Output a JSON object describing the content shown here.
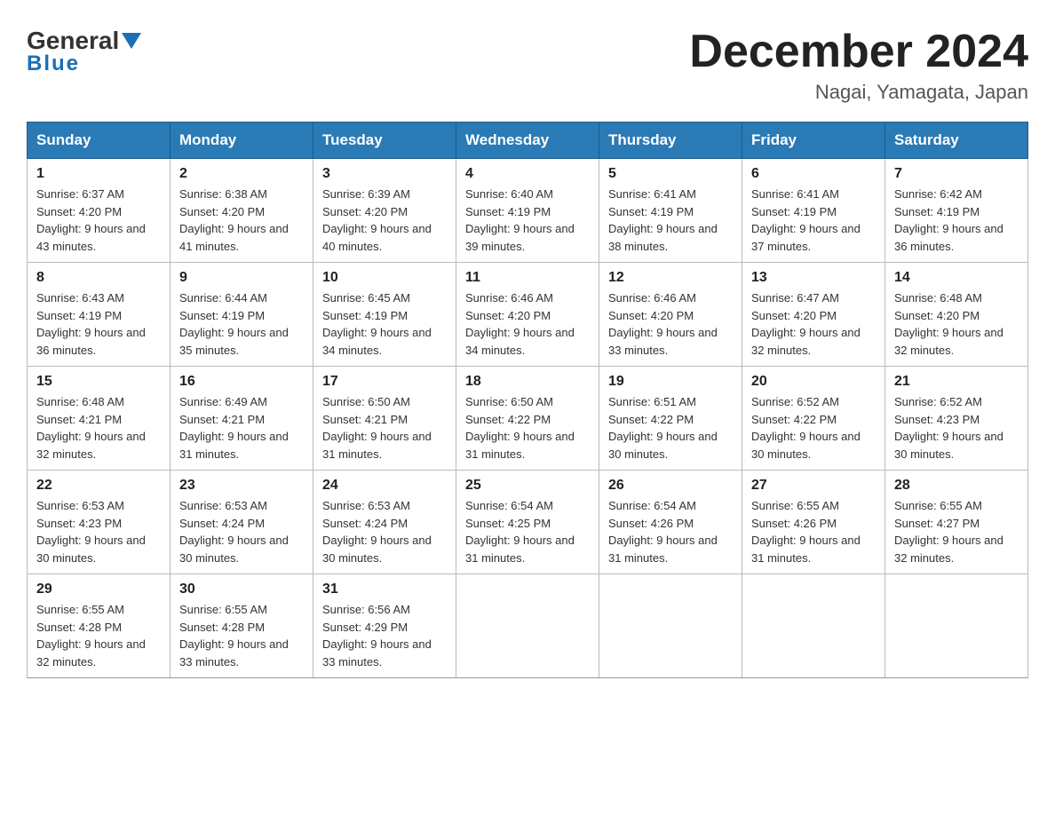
{
  "header": {
    "logo_general": "General",
    "logo_blue": "Blue",
    "title": "December 2024",
    "subtitle": "Nagai, Yamagata, Japan"
  },
  "calendar": {
    "days_of_week": [
      "Sunday",
      "Monday",
      "Tuesday",
      "Wednesday",
      "Thursday",
      "Friday",
      "Saturday"
    ],
    "weeks": [
      [
        {
          "day": "1",
          "sunrise": "6:37 AM",
          "sunset": "4:20 PM",
          "daylight": "9 hours and 43 minutes."
        },
        {
          "day": "2",
          "sunrise": "6:38 AM",
          "sunset": "4:20 PM",
          "daylight": "9 hours and 41 minutes."
        },
        {
          "day": "3",
          "sunrise": "6:39 AM",
          "sunset": "4:20 PM",
          "daylight": "9 hours and 40 minutes."
        },
        {
          "day": "4",
          "sunrise": "6:40 AM",
          "sunset": "4:19 PM",
          "daylight": "9 hours and 39 minutes."
        },
        {
          "day": "5",
          "sunrise": "6:41 AM",
          "sunset": "4:19 PM",
          "daylight": "9 hours and 38 minutes."
        },
        {
          "day": "6",
          "sunrise": "6:41 AM",
          "sunset": "4:19 PM",
          "daylight": "9 hours and 37 minutes."
        },
        {
          "day": "7",
          "sunrise": "6:42 AM",
          "sunset": "4:19 PM",
          "daylight": "9 hours and 36 minutes."
        }
      ],
      [
        {
          "day": "8",
          "sunrise": "6:43 AM",
          "sunset": "4:19 PM",
          "daylight": "9 hours and 36 minutes."
        },
        {
          "day": "9",
          "sunrise": "6:44 AM",
          "sunset": "4:19 PM",
          "daylight": "9 hours and 35 minutes."
        },
        {
          "day": "10",
          "sunrise": "6:45 AM",
          "sunset": "4:19 PM",
          "daylight": "9 hours and 34 minutes."
        },
        {
          "day": "11",
          "sunrise": "6:46 AM",
          "sunset": "4:20 PM",
          "daylight": "9 hours and 34 minutes."
        },
        {
          "day": "12",
          "sunrise": "6:46 AM",
          "sunset": "4:20 PM",
          "daylight": "9 hours and 33 minutes."
        },
        {
          "day": "13",
          "sunrise": "6:47 AM",
          "sunset": "4:20 PM",
          "daylight": "9 hours and 32 minutes."
        },
        {
          "day": "14",
          "sunrise": "6:48 AM",
          "sunset": "4:20 PM",
          "daylight": "9 hours and 32 minutes."
        }
      ],
      [
        {
          "day": "15",
          "sunrise": "6:48 AM",
          "sunset": "4:21 PM",
          "daylight": "9 hours and 32 minutes."
        },
        {
          "day": "16",
          "sunrise": "6:49 AM",
          "sunset": "4:21 PM",
          "daylight": "9 hours and 31 minutes."
        },
        {
          "day": "17",
          "sunrise": "6:50 AM",
          "sunset": "4:21 PM",
          "daylight": "9 hours and 31 minutes."
        },
        {
          "day": "18",
          "sunrise": "6:50 AM",
          "sunset": "4:22 PM",
          "daylight": "9 hours and 31 minutes."
        },
        {
          "day": "19",
          "sunrise": "6:51 AM",
          "sunset": "4:22 PM",
          "daylight": "9 hours and 30 minutes."
        },
        {
          "day": "20",
          "sunrise": "6:52 AM",
          "sunset": "4:22 PM",
          "daylight": "9 hours and 30 minutes."
        },
        {
          "day": "21",
          "sunrise": "6:52 AM",
          "sunset": "4:23 PM",
          "daylight": "9 hours and 30 minutes."
        }
      ],
      [
        {
          "day": "22",
          "sunrise": "6:53 AM",
          "sunset": "4:23 PM",
          "daylight": "9 hours and 30 minutes."
        },
        {
          "day": "23",
          "sunrise": "6:53 AM",
          "sunset": "4:24 PM",
          "daylight": "9 hours and 30 minutes."
        },
        {
          "day": "24",
          "sunrise": "6:53 AM",
          "sunset": "4:24 PM",
          "daylight": "9 hours and 30 minutes."
        },
        {
          "day": "25",
          "sunrise": "6:54 AM",
          "sunset": "4:25 PM",
          "daylight": "9 hours and 31 minutes."
        },
        {
          "day": "26",
          "sunrise": "6:54 AM",
          "sunset": "4:26 PM",
          "daylight": "9 hours and 31 minutes."
        },
        {
          "day": "27",
          "sunrise": "6:55 AM",
          "sunset": "4:26 PM",
          "daylight": "9 hours and 31 minutes."
        },
        {
          "day": "28",
          "sunrise": "6:55 AM",
          "sunset": "4:27 PM",
          "daylight": "9 hours and 32 minutes."
        }
      ],
      [
        {
          "day": "29",
          "sunrise": "6:55 AM",
          "sunset": "4:28 PM",
          "daylight": "9 hours and 32 minutes."
        },
        {
          "day": "30",
          "sunrise": "6:55 AM",
          "sunset": "4:28 PM",
          "daylight": "9 hours and 33 minutes."
        },
        {
          "day": "31",
          "sunrise": "6:56 AM",
          "sunset": "4:29 PM",
          "daylight": "9 hours and 33 minutes."
        },
        null,
        null,
        null,
        null
      ]
    ]
  }
}
